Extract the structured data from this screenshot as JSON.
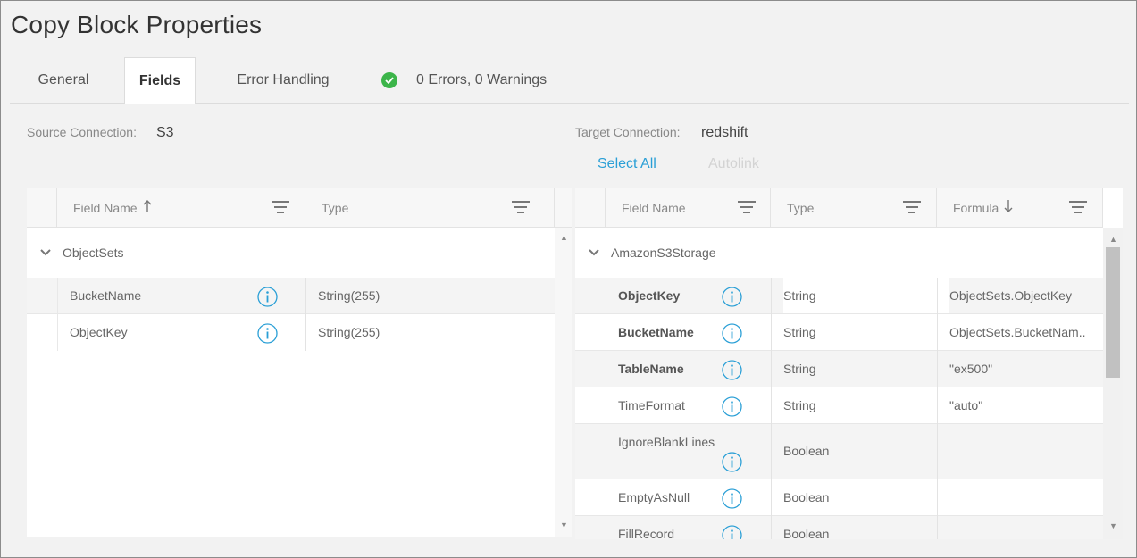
{
  "title": "Copy Block Properties",
  "tabs": [
    {
      "label": "General"
    },
    {
      "label": "Fields"
    },
    {
      "label": "Error Handling"
    }
  ],
  "status": {
    "text": "0 Errors, 0 Warnings",
    "icon": "check-circle-icon",
    "color": "#3cb54a"
  },
  "source": {
    "label": "Source Connection:",
    "value": "S3",
    "columns": {
      "field_name": "Field Name",
      "type": "Type"
    },
    "sort_field": "up",
    "group": "ObjectSets",
    "rows": [
      {
        "name": "BucketName",
        "type": "String(255)"
      },
      {
        "name": "ObjectKey",
        "type": "String(255)"
      }
    ]
  },
  "target": {
    "label": "Target Connection:",
    "value": "redshift",
    "select_all": "Select All",
    "autolink": "Autolink",
    "columns": {
      "field_name": "Field Name",
      "type": "Type",
      "formula": "Formula"
    },
    "sort_formula": "down",
    "group": "AmazonS3Storage",
    "rows": [
      {
        "name": "ObjectKey",
        "type": "String",
        "formula": "ObjectSets.ObjectKey"
      },
      {
        "name": "BucketName",
        "type": "String",
        "formula": "ObjectSets.BucketNam.."
      },
      {
        "name": "TableName",
        "type": "String",
        "formula": "\"ex500\""
      },
      {
        "name": "TimeFormat",
        "type": "String",
        "formula": "\"auto\""
      },
      {
        "name": "IgnoreBlankLines",
        "type": "Boolean",
        "formula": ""
      },
      {
        "name": "EmptyAsNull",
        "type": "Boolean",
        "formula": ""
      },
      {
        "name": "FillRecord",
        "type": "Boolean",
        "formula": ""
      }
    ]
  },
  "colors": {
    "accent": "#2a9fd6",
    "success": "#3cb54a"
  }
}
